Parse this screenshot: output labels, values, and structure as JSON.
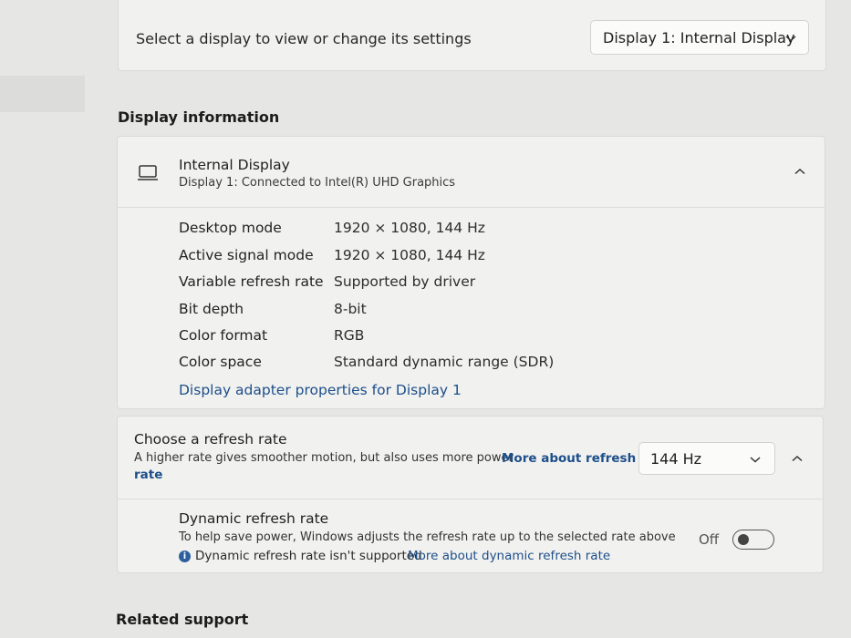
{
  "display_selector": {
    "label": "Select a display to view or change its settings",
    "selected": "Display 1: Internal Display"
  },
  "display_info": {
    "section_title": "Display information",
    "name": "Internal Display",
    "connection": "Display 1: Connected to Intel(R) UHD Graphics",
    "properties": [
      {
        "label": "Desktop mode",
        "value": "1920 × 1080, 144 Hz"
      },
      {
        "label": "Active signal mode",
        "value": "1920 × 1080, 144 Hz"
      },
      {
        "label": "Variable refresh rate",
        "value": "Supported by driver"
      },
      {
        "label": "Bit depth",
        "value": "8-bit"
      },
      {
        "label": "Color format",
        "value": "RGB"
      },
      {
        "label": "Color space",
        "value": "Standard dynamic range (SDR)"
      }
    ],
    "adapter_link": "Display adapter properties for Display 1"
  },
  "refresh_rate": {
    "title": "Choose a refresh rate",
    "desc": "A higher rate gives smoother motion, but also uses more power",
    "link_part1": "More about refresh",
    "link_part2": "rate",
    "selected": "144 Hz"
  },
  "dynamic_refresh": {
    "title": "Dynamic refresh rate",
    "desc": "To help save power, Windows adjusts the refresh rate up to the selected rate above",
    "toggle_state": "Off",
    "toggle_on": false,
    "notice": "Dynamic refresh rate isn't supported",
    "notice_link": "More about dynamic refresh rate"
  },
  "related_support": {
    "title": "Related support"
  },
  "icons": {
    "monitor": "laptop-icon",
    "chevron_down": "chevron-down-icon",
    "chevron_up": "chevron-up-icon",
    "info": "info-icon"
  },
  "colors": {
    "accent_link": "#1d4f8a",
    "card_bg": "#f1f1ef",
    "page_bg": "#e6e6e4",
    "info_badge": "#2d5f9f"
  }
}
